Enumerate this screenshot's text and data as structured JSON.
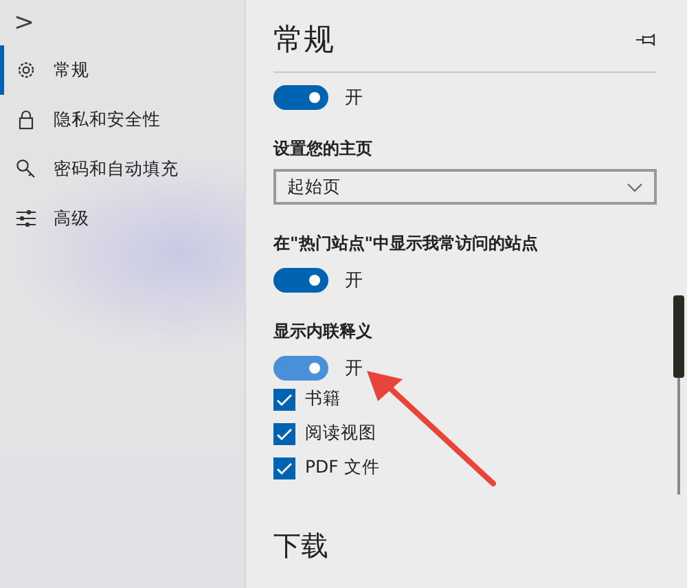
{
  "sidebar": {
    "expand_glyph": ">",
    "items": [
      {
        "label": "常规",
        "selected": true
      },
      {
        "label": "隐私和安全性",
        "selected": false
      },
      {
        "label": "密码和自动填充",
        "selected": false
      },
      {
        "label": "高级",
        "selected": false
      }
    ]
  },
  "panel": {
    "title": "常规",
    "sections": [
      {
        "kind": "toggle",
        "on": true,
        "hovered": false,
        "state_label": "开"
      },
      {
        "kind": "heading",
        "text": "设置您的主页"
      },
      {
        "kind": "dropdown",
        "value": "起始页"
      },
      {
        "kind": "heading",
        "text": "在\"热门站点\"中显示我常访问的站点"
      },
      {
        "kind": "toggle",
        "on": true,
        "hovered": false,
        "state_label": "开"
      },
      {
        "kind": "heading",
        "text": "显示内联释义"
      },
      {
        "kind": "toggle",
        "on": true,
        "hovered": true,
        "state_label": "开"
      },
      {
        "kind": "checkbox",
        "checked": true,
        "label": "书籍"
      },
      {
        "kind": "checkbox",
        "checked": true,
        "label": "阅读视图"
      },
      {
        "kind": "checkbox",
        "checked": true,
        "label": "PDF 文件"
      },
      {
        "kind": "section_title",
        "text": "下载"
      }
    ]
  }
}
